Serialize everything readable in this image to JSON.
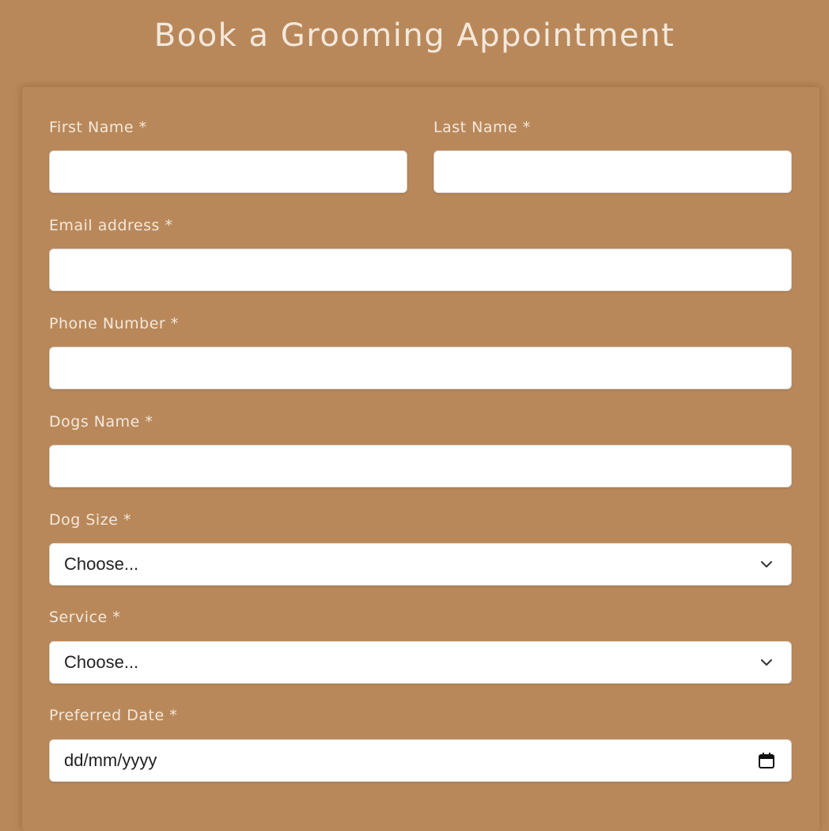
{
  "page": {
    "title": "Book a Grooming Appointment",
    "background_color": "#b9885a",
    "text_color": "#f3e8dc"
  },
  "form": {
    "first_name": {
      "label": "First Name *",
      "value": ""
    },
    "last_name": {
      "label": "Last Name *",
      "value": ""
    },
    "email": {
      "label": "Email address *",
      "value": ""
    },
    "phone": {
      "label": "Phone Number *",
      "value": ""
    },
    "dog_name": {
      "label": "Dogs Name *",
      "value": ""
    },
    "dog_size": {
      "label": "Dog Size *",
      "selected": "Choose...",
      "icon": "chevron-down-icon"
    },
    "service": {
      "label": "Service *",
      "selected": "Choose...",
      "icon": "chevron-down-icon"
    },
    "preferred_date": {
      "label": "Preferred Date *",
      "placeholder": "dd/mm/yyyy",
      "icon": "calendar-icon"
    }
  }
}
